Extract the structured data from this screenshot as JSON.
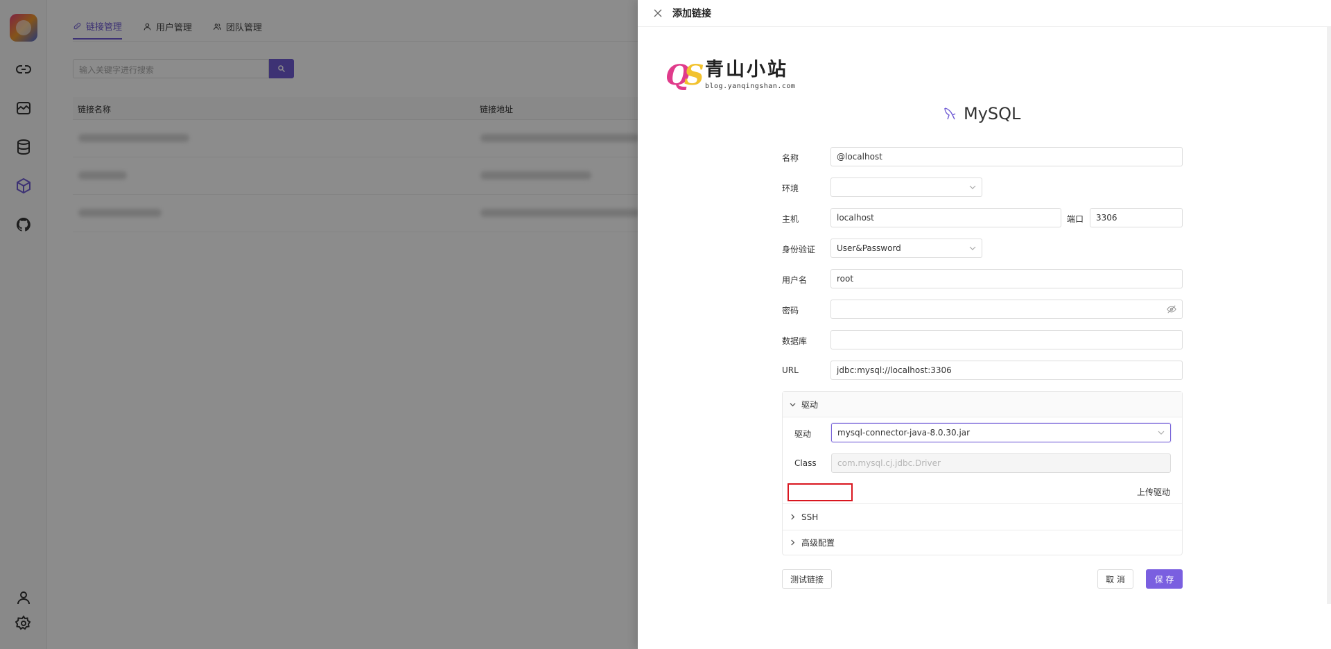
{
  "tabs": [
    {
      "label": "链接管理",
      "icon": "link-icon",
      "active": true
    },
    {
      "label": "用户管理",
      "icon": "user-icon",
      "active": false
    },
    {
      "label": "团队管理",
      "icon": "team-icon",
      "active": false
    }
  ],
  "search": {
    "placeholder": "输入关键字进行搜索"
  },
  "table": {
    "columns": [
      "链接名称",
      "链接地址"
    ]
  },
  "drawer": {
    "title": "添加链接",
    "brand": {
      "mark_q": "Q",
      "mark_s": "S",
      "name": "青山小站",
      "url": "blog.yanqingshan.com"
    },
    "db_name": "MySQL",
    "fields": {
      "name": {
        "label": "名称",
        "value": "@localhost"
      },
      "env": {
        "label": "环境",
        "value": ""
      },
      "host": {
        "label": "主机",
        "value": "localhost"
      },
      "port": {
        "label": "端口",
        "value": "3306"
      },
      "auth": {
        "label": "身份验证",
        "value": "User&Password"
      },
      "username": {
        "label": "用户名",
        "value": "root"
      },
      "password": {
        "label": "密码",
        "value": ""
      },
      "database": {
        "label": "数据库",
        "value": ""
      },
      "url": {
        "label": "URL",
        "value": "jdbc:mysql://localhost:3306"
      }
    },
    "driver_section": {
      "title": "驱动",
      "driver_label": "驱动",
      "driver_value": "mysql-connector-java-8.0.30.jar",
      "class_label": "Class",
      "class_value": "com.mysql.cj.jdbc.Driver",
      "upload_label": "上传驱动"
    },
    "ssh_section": {
      "title": "SSH"
    },
    "advanced_section": {
      "title": "高级配置"
    },
    "buttons": {
      "test": "测试链接",
      "cancel": "取 消",
      "save": "保 存"
    }
  },
  "colors": {
    "accent": "#7a5fe0",
    "highlight": "#d9161f"
  }
}
